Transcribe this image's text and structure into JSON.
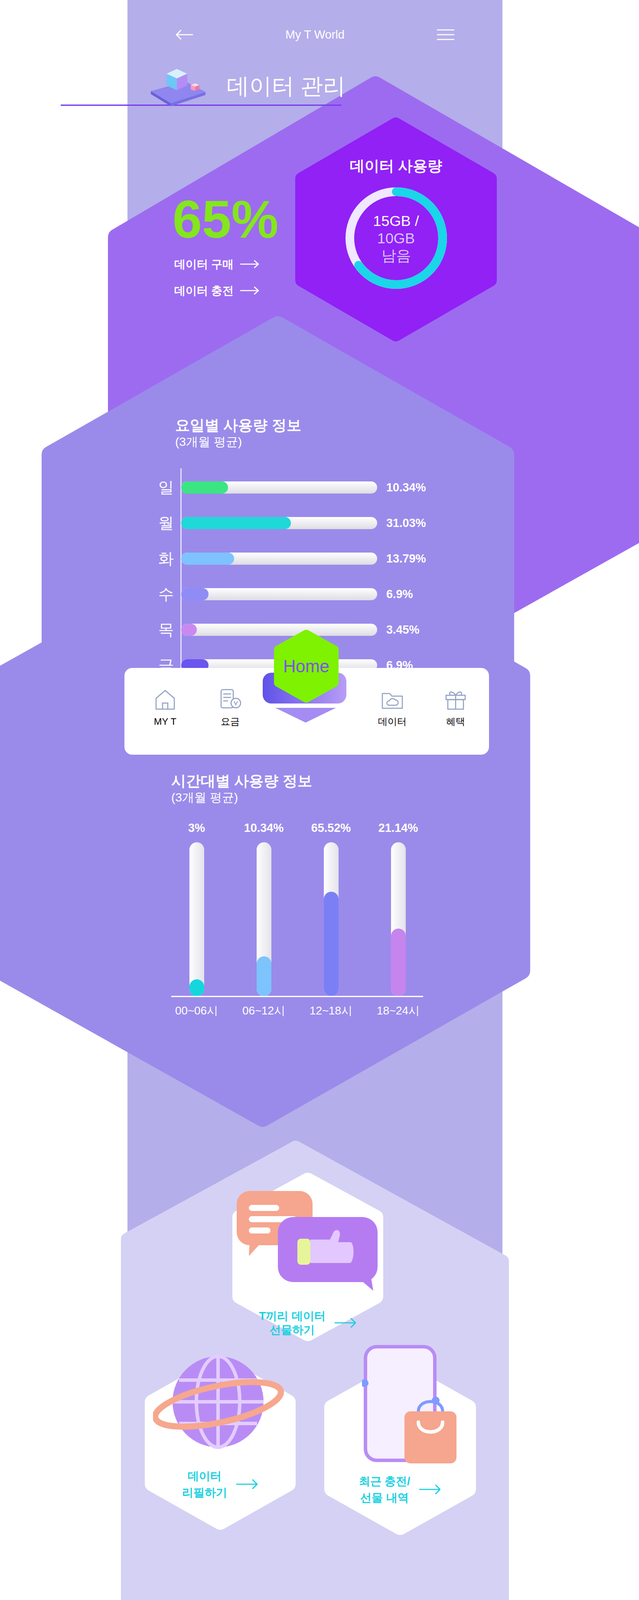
{
  "header": {
    "title": "My T World"
  },
  "page_title": "데이터 관리",
  "usage": {
    "percent": "65%",
    "links": [
      {
        "label": "데이터 구매"
      },
      {
        "label": "데이터 충전"
      }
    ],
    "card_title": "데이터 사용량",
    "total": "15GB /",
    "remaining": "10GB",
    "remaining_label": "남음",
    "level": 0.65
  },
  "weekday_chart": {
    "title": "요일별 사용량 정보",
    "subtitle": "(3개월 평균)",
    "rows": [
      {
        "day": "일",
        "reading": "10.34%",
        "level": 0.24,
        "color": "#3be583"
      },
      {
        "day": "월",
        "reading": "31.03%",
        "level": 0.56,
        "color": "#1fd8d8"
      },
      {
        "day": "화",
        "reading": "13.79%",
        "level": 0.27,
        "color": "#7ec3ff"
      },
      {
        "day": "수",
        "reading": "6.9%",
        "level": 0.14,
        "color": "#8f8cf6"
      },
      {
        "day": "목",
        "reading": "3.45%",
        "level": 0.08,
        "color": "#c98af0"
      },
      {
        "day": "금",
        "reading": "6.9%",
        "level": 0.14,
        "color": "#6a55ee"
      }
    ]
  },
  "nav": {
    "items": [
      {
        "label": "MY T",
        "kind": "tab",
        "selected": false
      },
      {
        "label": "요금",
        "kind": "tab",
        "selected": false
      },
      {
        "label": "Home",
        "kind": "home",
        "selected": true
      },
      {
        "label": "데이터",
        "kind": "tab",
        "selected": false
      },
      {
        "label": "혜택",
        "kind": "tab",
        "selected": false
      }
    ]
  },
  "hourly_chart": {
    "title": "시간대별 사용량 정보",
    "subtitle": "(3개월 평균)",
    "bars": [
      {
        "label": "00~06시",
        "reading": "3%",
        "level": 0.11,
        "color": "#14d6dc"
      },
      {
        "label": "06~12시",
        "reading": "10.34%",
        "level": 0.26,
        "color": "#7cc4fb"
      },
      {
        "label": "12~18시",
        "reading": "65.52%",
        "level": 0.68,
        "color": "#7b7ff5"
      },
      {
        "label": "18~24시",
        "reading": "21.14%",
        "level": 0.44,
        "color": "#c684ee"
      }
    ]
  },
  "actions": [
    {
      "lines": [
        "T끼리 데이터",
        "선물하기"
      ]
    },
    {
      "lines": [
        "데이터",
        "리필하기"
      ]
    },
    {
      "lines": [
        "최근 충전/",
        "선물 내역"
      ]
    }
  ]
}
